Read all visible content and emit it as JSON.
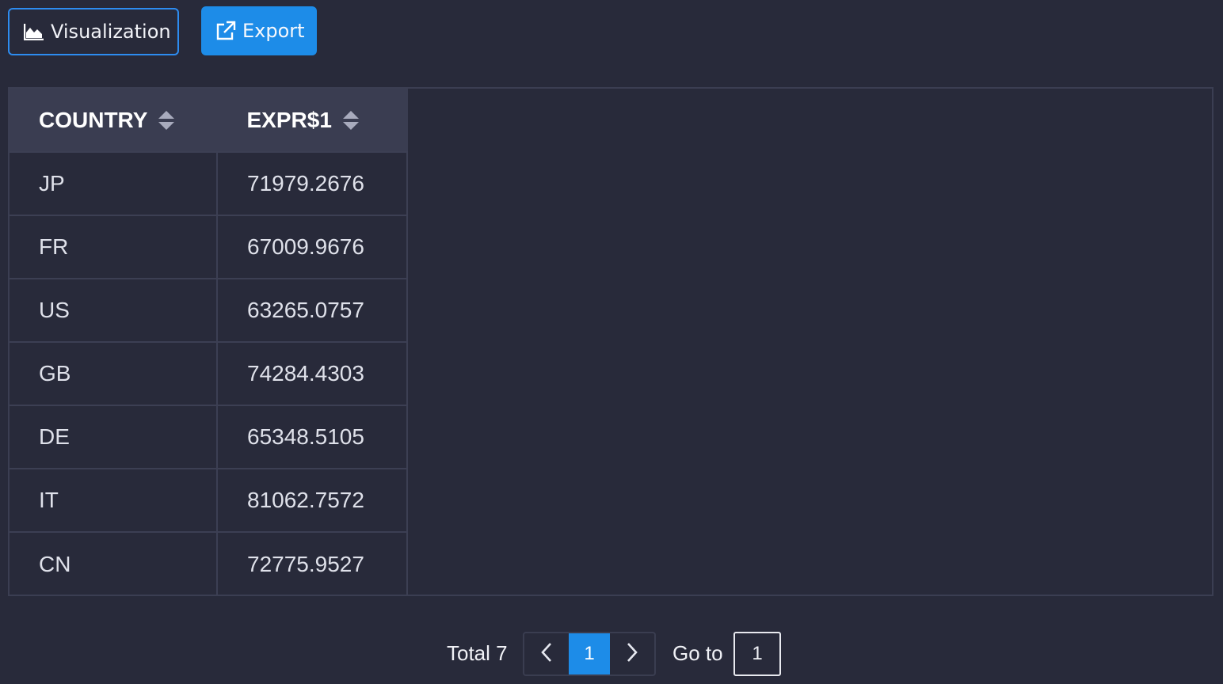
{
  "toolbar": {
    "visualization_label": "Visualization",
    "visualization_icon": "area-chart-icon",
    "export_label": "Export",
    "export_icon": "external-link-icon"
  },
  "table": {
    "columns": [
      {
        "label": "COUNTRY",
        "sort_icon": "sort-icon"
      },
      {
        "label": "EXPR$1",
        "sort_icon": "sort-icon"
      }
    ],
    "rows": [
      {
        "country": "JP",
        "value": "71979.2676"
      },
      {
        "country": "FR",
        "value": "67009.9676"
      },
      {
        "country": "US",
        "value": "63265.0757"
      },
      {
        "country": "GB",
        "value": "74284.4303"
      },
      {
        "country": "DE",
        "value": "65348.5105"
      },
      {
        "country": "IT",
        "value": "81062.7572"
      },
      {
        "country": "CN",
        "value": "72775.9527"
      }
    ]
  },
  "pagination": {
    "total_label": "Total 7",
    "current_page": "1",
    "goto_label": "Go to",
    "goto_value": "1"
  },
  "colors": {
    "background": "#282a3a",
    "header_background": "#3a3d51",
    "accent": "#1d8ce8",
    "border": "#3c3f53"
  }
}
